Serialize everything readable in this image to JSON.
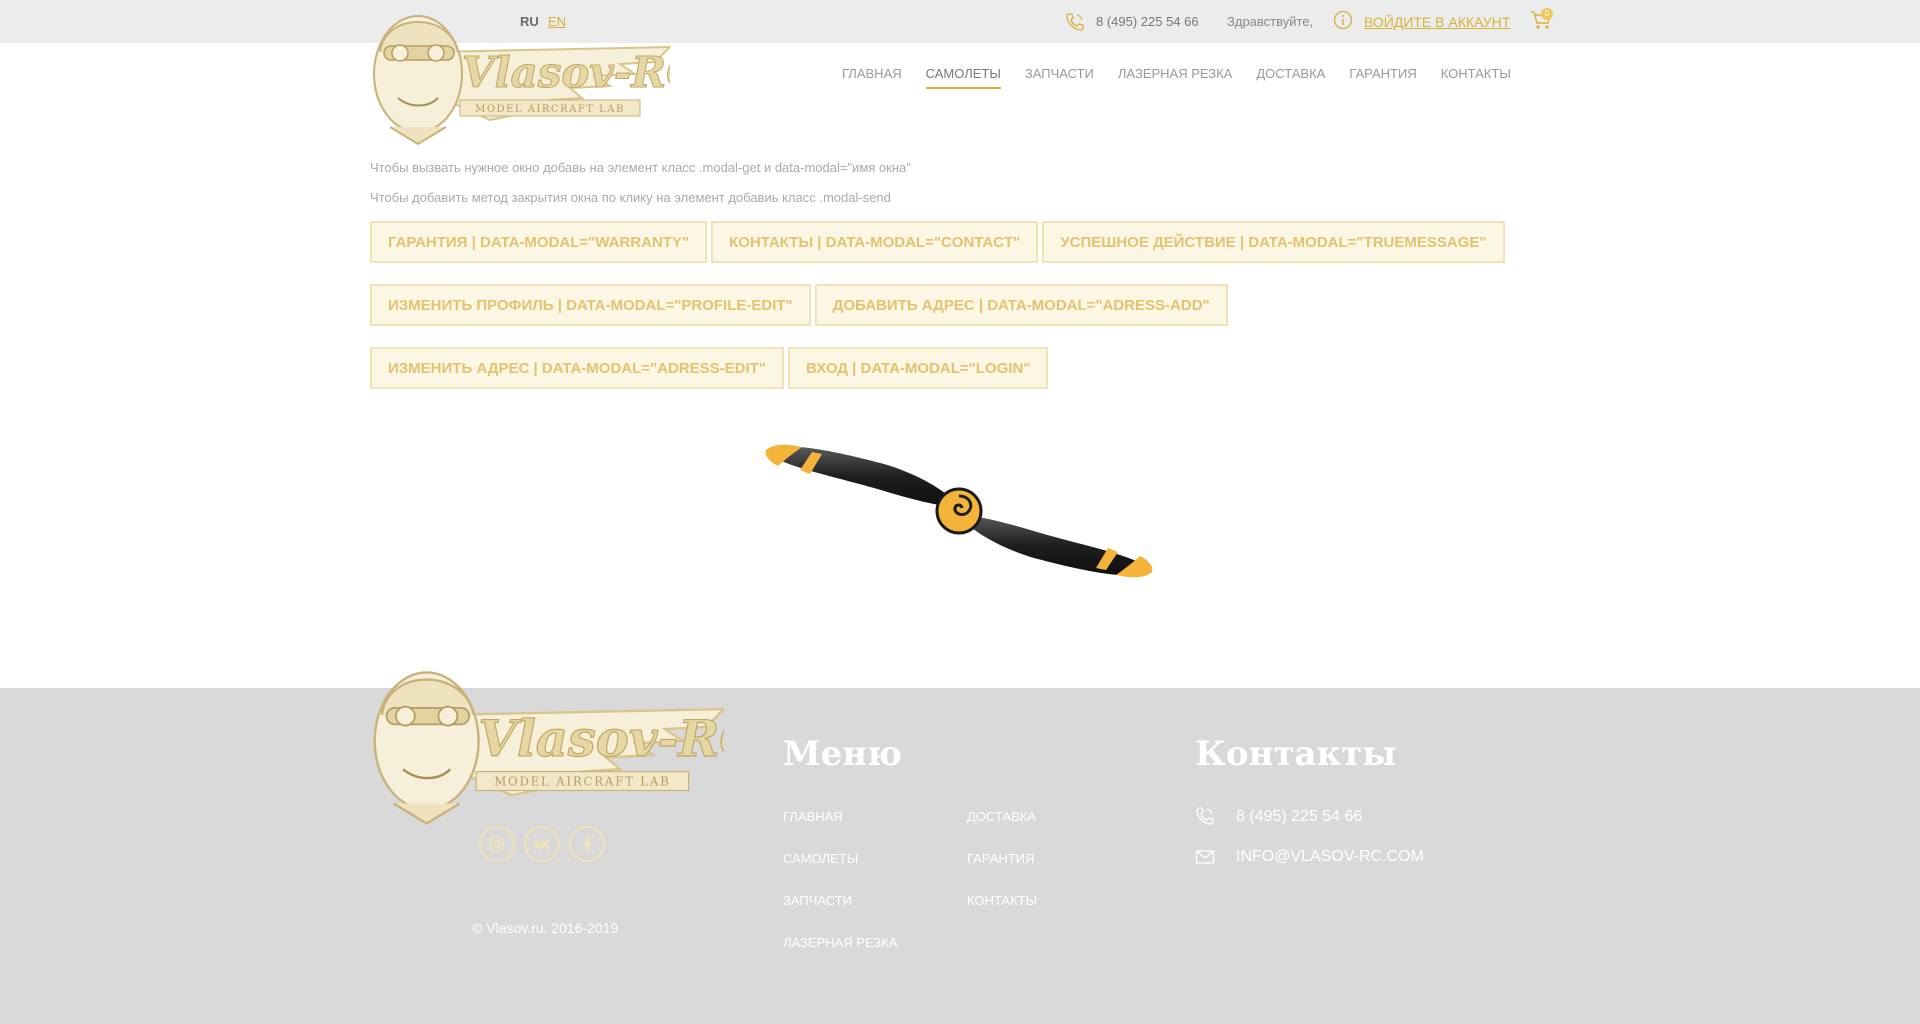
{
  "topbar": {
    "lang_ru": "RU",
    "lang_en": "EN",
    "phone": "8 (495) 225 54 66",
    "greeting": "Здравствуйте,",
    "login": "Войдите в аккаунт",
    "cart_count": "0"
  },
  "nav": {
    "items": [
      "Главная",
      "Самолеты",
      "Запчасти",
      "Лазерная резка",
      "Доставка",
      "Гарантия",
      "Контакты"
    ],
    "active": "Самолеты"
  },
  "content": {
    "hint_1": "Чтобы вызвать нужное окно добавь на элемент класс .modal-get и data-modal=\"имя окна\"",
    "hint_2": "Чтобы добавить метод закрытия окна по клику на элемент добавиь класс .modal-send",
    "buttons": [
      "Гарантия | data-modal=\"warranty\"",
      "Контакты | data-modal=\"contact\"",
      "Успешное действие | data-modal=\"truemessage\"",
      "Изменить профиль | data-modal=\"profile-edit\"",
      "Добавить адрес | data-modal=\"adress-add\"",
      "Изменить адрес | data-modal=\"adress-edit\"",
      "Вход | data-modal=\"login\""
    ]
  },
  "logo": {
    "brand": "Vlasov-RC",
    "tagline": "MODEL AIRCRAFT LAB"
  },
  "footer": {
    "menu_title": "Меню",
    "contacts_title": "Контакты",
    "menu_col_1": [
      "Главная",
      "Самолеты",
      "Запчасти",
      "Лазерная резка"
    ],
    "menu_col_2": [
      "Доставка",
      "Гарантия",
      "Контакты"
    ],
    "phone": "8 (495) 225 54 66",
    "email": "INFO@VLASOV-RC.COM",
    "copyright": "© Vlasov.ru, 2016-2019"
  },
  "colors": {
    "accent": "#d8b13a",
    "button_bg": "#fcf6e4",
    "button_text": "#e1c46f",
    "footer_bg": "#d9d9d9",
    "topbar_bg": "#ececec"
  }
}
